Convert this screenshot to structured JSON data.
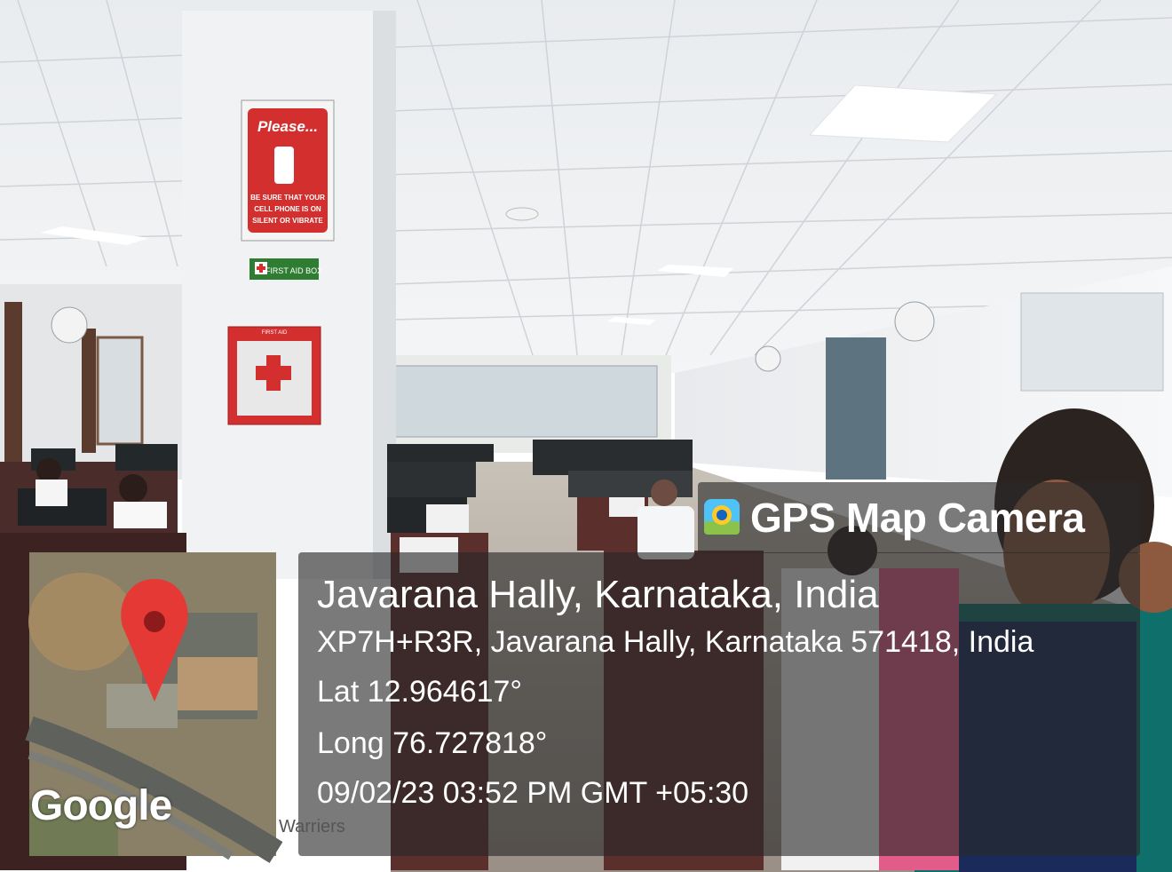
{
  "overlay": {
    "app_name": "GPS Map Camera",
    "location_title": "Javarana Hally, Karnataka, India",
    "address": "XP7H+R3R, Javarana Hally, Karnataka 571418, India",
    "latitude": "Lat 12.964617°",
    "longitude": "Long 76.727818°",
    "datetime": "09/02/23 03:52 PM GMT +05:30"
  },
  "map": {
    "watermark": "Google",
    "pin_color": "#e53935"
  },
  "scene": {
    "sign_heading": "Please...",
    "sign_body_1": "BE SURE THAT YOUR",
    "sign_body_2": "CELL PHONE IS ON",
    "sign_body_3": "SILENT OR VIBRATE",
    "first_aid_label": "FIRST AID BOX",
    "box_label": "FIRST AID",
    "desk_label": "Warriers"
  },
  "colors": {
    "sign_red": "#d32f2f",
    "overlay_bg": "rgba(40,40,40,0.62)",
    "firstaid_green": "#2e7d32"
  }
}
